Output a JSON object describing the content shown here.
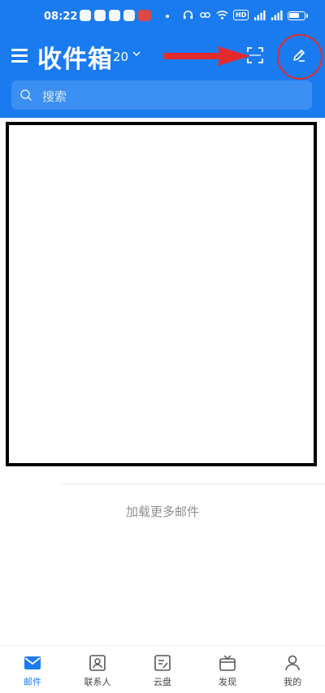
{
  "status_bar": {
    "time": "08:22",
    "hd_label": "HD"
  },
  "header": {
    "title": "收件箱",
    "count": "20"
  },
  "search": {
    "placeholder": "搜索"
  },
  "list": {
    "load_more": "加载更多邮件"
  },
  "tabbar": {
    "tabs": [
      {
        "label": "邮件",
        "icon": "mail-icon",
        "active": true
      },
      {
        "label": "联系人",
        "icon": "contacts-icon",
        "active": false
      },
      {
        "label": "云盘",
        "icon": "cloud-drive-icon",
        "active": false
      },
      {
        "label": "发现",
        "icon": "discover-icon",
        "active": false
      },
      {
        "label": "我的",
        "icon": "profile-icon",
        "active": false
      }
    ]
  },
  "colors": {
    "brand_blue": "#1a7bf0",
    "annotation_red": "#e42b2b"
  }
}
